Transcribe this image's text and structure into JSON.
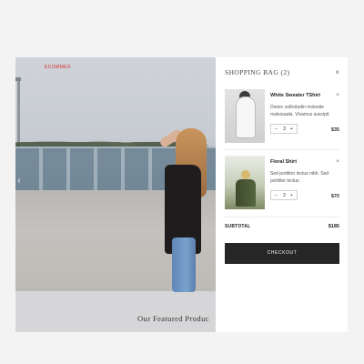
{
  "store": {
    "brand": "ECOMMED",
    "featured_heading": "Our Featured Produc",
    "prev_arrow": "‹"
  },
  "bag": {
    "title": "Shopping Bag (2)",
    "close": "×",
    "items": [
      {
        "name": "White Sweater TShirt",
        "description": "Donec sollicitudin molestie malesuada. Vivamus suscipit.",
        "qty_minus": "−",
        "quantity": "3",
        "qty_plus": "+",
        "price": "$35",
        "remove": "×"
      },
      {
        "name": "Floral Shirt",
        "description": "Sed porttitor lectus nibh. Sed porttitor lectus.",
        "qty_minus": "−",
        "quantity": "2",
        "qty_plus": "+",
        "price": "$70",
        "remove": "×"
      }
    ],
    "subtotal_label": "Subtotal",
    "subtotal_value": "$185",
    "checkout_label": "Checkout"
  },
  "colors": {
    "brand_red": "#d72e2e",
    "checkout_bg": "#262626",
    "page_bg": "#f3f3f4"
  },
  "icons": [
    "chevron-left-icon",
    "close-icon",
    "minus-icon",
    "plus-icon"
  ]
}
